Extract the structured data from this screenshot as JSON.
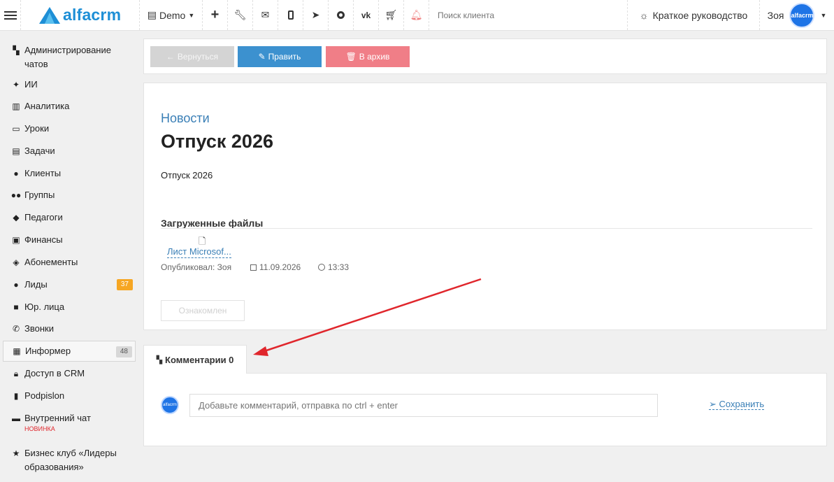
{
  "topbar": {
    "logo": "alfacrm",
    "demo_label": "Demo",
    "search_placeholder": "Поиск клиента",
    "guide_label": "Краткое руководство",
    "user_name": "Зоя",
    "avatar_text": "alfacrm"
  },
  "sidebar": {
    "items": [
      {
        "label": "Администрирование чатов",
        "icon": "chats-icon"
      },
      {
        "label": "ИИ",
        "icon": "sparkle-icon"
      },
      {
        "label": "Аналитика",
        "icon": "map-icon"
      },
      {
        "label": "Уроки",
        "icon": "calendar-icon"
      },
      {
        "label": "Задачи",
        "icon": "clipboard-icon"
      },
      {
        "label": "Клиенты",
        "icon": "user-icon"
      },
      {
        "label": "Группы",
        "icon": "users-icon"
      },
      {
        "label": "Педагоги",
        "icon": "graduation-cap-icon"
      },
      {
        "label": "Финансы",
        "icon": "money-icon"
      },
      {
        "label": "Абонементы",
        "icon": "tag-icon"
      },
      {
        "label": "Лиды",
        "icon": "user-plus-icon",
        "badge": "37"
      },
      {
        "label": "Юр. лица",
        "icon": "briefcase-icon"
      },
      {
        "label": "Звонки",
        "icon": "phone-icon"
      },
      {
        "label": "Информер",
        "icon": "informer-icon",
        "badge": "48"
      },
      {
        "label": "Доступ в CRM",
        "icon": "lock-icon"
      },
      {
        "label": "Podpislon",
        "icon": "document-icon"
      },
      {
        "label": "Внутренний чат",
        "icon": "chat-icon",
        "tag": "НОВИНКА"
      },
      {
        "label": "Бизнес клуб «Лидеры образования»",
        "icon": "star-icon"
      }
    ]
  },
  "toolbar": {
    "back_label": "Вернуться",
    "edit_label": "Править",
    "archive_label": "В архив"
  },
  "article": {
    "category": "Новости",
    "title": "Отпуск 2026",
    "body": "Отпуск 2026",
    "files_heading": "Загруженные файлы",
    "file_name": "Лист Microsof...",
    "published_by": "Опубликовал: Зоя",
    "date": "11.09.2026",
    "time": "13:33",
    "ack_label": "Ознакомлен"
  },
  "comments": {
    "tab_label": "Комментарии 0",
    "input_placeholder": "Добавьте комментарий, отправка по ctrl + enter",
    "save_label": "Сохранить"
  },
  "colors": {
    "brand": "#1e8fd6",
    "edit_button": "#3c91cf",
    "archive_button": "#f07e87",
    "badge_orange": "#f6a623",
    "annotation_arrow": "#e0262c"
  }
}
